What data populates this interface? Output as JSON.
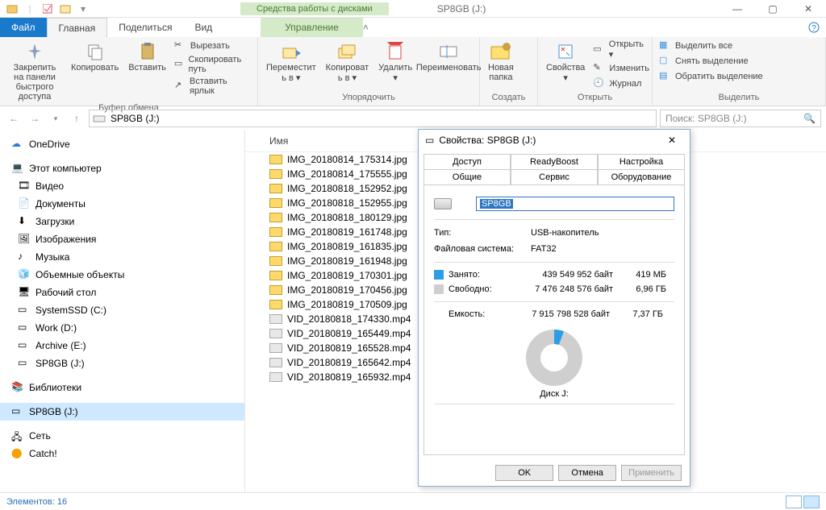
{
  "window": {
    "title": "SP8GB (J:)",
    "contextual_tab_header": "Средства работы с дисками"
  },
  "tabs": {
    "file": "Файл",
    "home": "Главная",
    "share": "Поделиться",
    "view": "Вид",
    "manage": "Управление"
  },
  "ribbon": {
    "clipboard": {
      "label": "Буфер обмена",
      "pin": "Закрепить на панели\nбыстрого доступа",
      "copy": "Копировать",
      "paste": "Вставить",
      "cut": "Вырезать",
      "copypath": "Скопировать путь",
      "pasteshortcut": "Вставить ярлык"
    },
    "organize": {
      "label": "Упорядочить",
      "moveto": "Переместит\nь в ▾",
      "copyto": "Копироват\nь в ▾",
      "delete": "Удалить\n▾",
      "rename": "Переименовать"
    },
    "create": {
      "label": "Создать",
      "newfolder": "Новая\nпапка"
    },
    "open": {
      "label": "Открыть",
      "props": "Свойства\n▾",
      "open": "Открыть ▾",
      "edit": "Изменить",
      "history": "Журнал"
    },
    "select": {
      "label": "Выделить",
      "selectall": "Выделить все",
      "selectnone": "Снять выделение",
      "invert": "Обратить выделение"
    }
  },
  "address": {
    "path": "SP8GB (J:)",
    "search_placeholder": "Поиск: SP8GB (J:)"
  },
  "tree": {
    "onedrive": "OneDrive",
    "thispc": "Этот компьютер",
    "videos": "Видео",
    "documents": "Документы",
    "downloads": "Загрузки",
    "pictures": "Изображения",
    "music": "Музыка",
    "objects3d": "Объемные объекты",
    "desktop": "Рабочий стол",
    "ssd": "SystemSSD (C:)",
    "work": "Work (D:)",
    "archive": "Archive (E:)",
    "sp8gb": "SP8GB (J:)",
    "libraries": "Библиотеки",
    "sp8gb2": "SP8GB (J:)",
    "network": "Сеть",
    "catch": "Catch!"
  },
  "files": {
    "col_name": "Имя",
    "items": [
      "IMG_20180814_175314.jpg",
      "IMG_20180814_175555.jpg",
      "IMG_20180818_152952.jpg",
      "IMG_20180818_152955.jpg",
      "IMG_20180818_180129.jpg",
      "IMG_20180819_161748.jpg",
      "IMG_20180819_161835.jpg",
      "IMG_20180819_161948.jpg",
      "IMG_20180819_170301.jpg",
      "IMG_20180819_170456.jpg",
      "IMG_20180819_170509.jpg",
      "VID_20180818_174330.mp4",
      "VID_20180819_165449.mp4",
      "VID_20180819_165528.mp4",
      "VID_20180819_165642.mp4",
      "VID_20180819_165932.mp4"
    ]
  },
  "status": {
    "count_label": "Элементов: 16"
  },
  "props": {
    "title": "Свойства: SP8GB (J:)",
    "tabs": {
      "access": "Доступ",
      "readyboost": "ReadyBoost",
      "custom": "Настройка",
      "general": "Общие",
      "service": "Сервис",
      "hardware": "Оборудование"
    },
    "name_value": "SP8GB",
    "type_label": "Тип:",
    "type_value": "USB-накопитель",
    "fs_label": "Файловая система:",
    "fs_value": "FAT32",
    "used_label": "Занято:",
    "used_bytes": "439 549 952 байт",
    "used_h": "419 МБ",
    "free_label": "Свободно:",
    "free_bytes": "7 476 248 576 байт",
    "free_h": "6,96 ГБ",
    "cap_label": "Емкость:",
    "cap_bytes": "7 915 798 528 байт",
    "cap_h": "7,37 ГБ",
    "diskname": "Диск J:",
    "ok": "OK",
    "cancel": "Отмена",
    "apply": "Применить"
  }
}
